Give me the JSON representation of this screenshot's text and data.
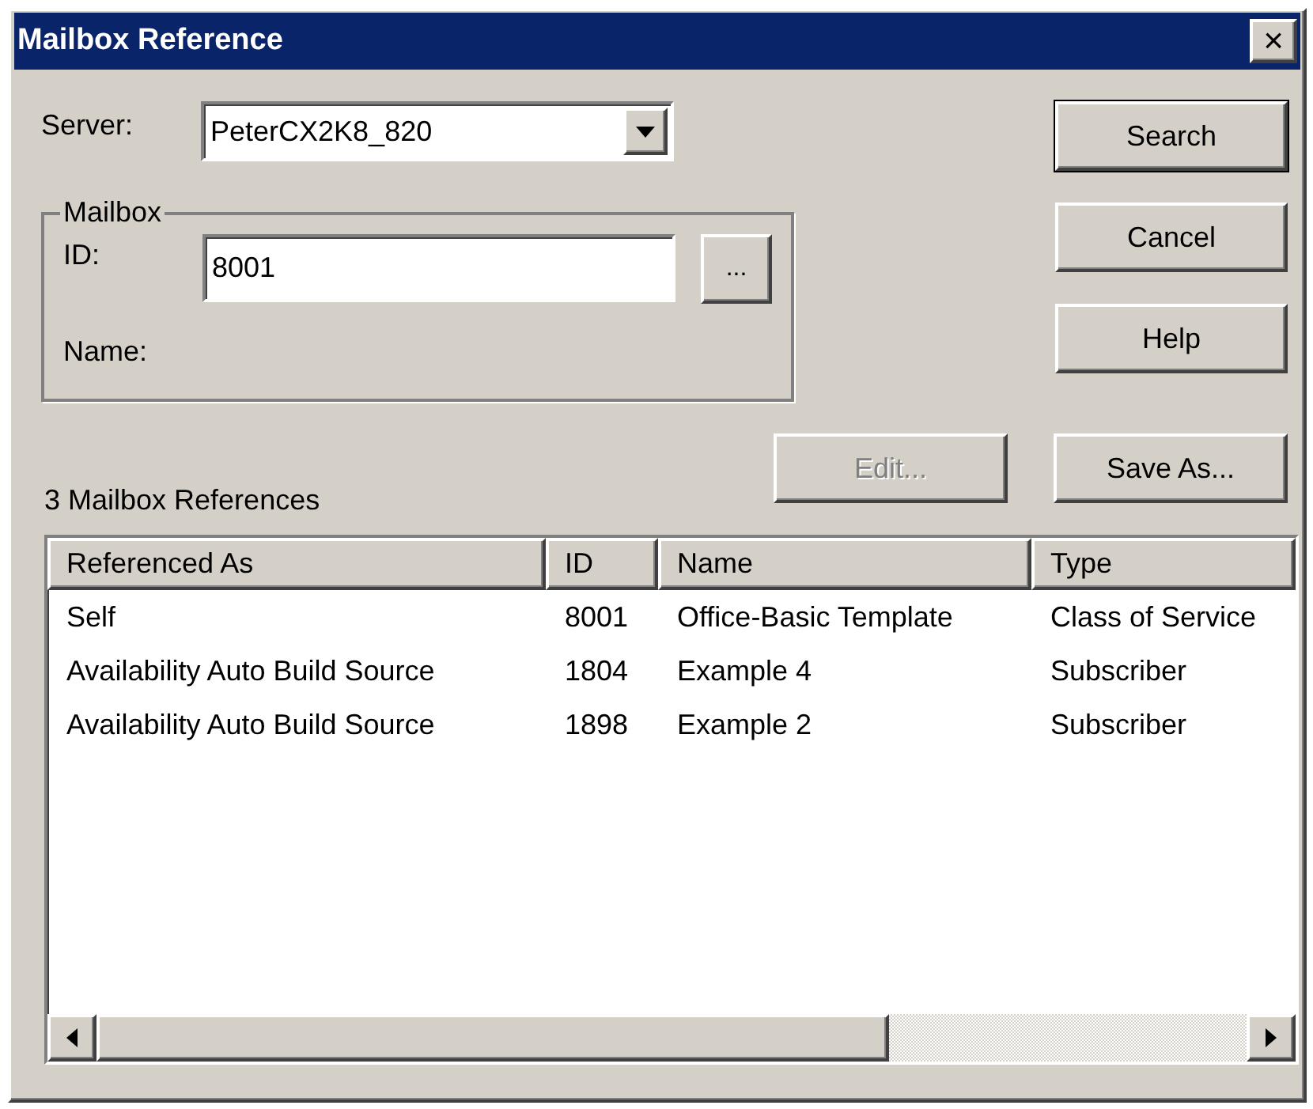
{
  "window": {
    "title": "Mailbox Reference",
    "close": "×"
  },
  "server": {
    "label": "Server:",
    "value": "PeterCX2K8_820"
  },
  "mailbox": {
    "legend": "Mailbox",
    "id_label": "ID:",
    "id_value": "8001",
    "browse": "...",
    "name_label": "Name:"
  },
  "action_buttons": [
    {
      "label": "Search",
      "default": true
    },
    {
      "label": "Cancel",
      "default": false
    },
    {
      "label": "Help",
      "default": false
    }
  ],
  "list_buttons": [
    {
      "label": "Edit...",
      "disabled": true
    },
    {
      "label": "Save As...",
      "disabled": false
    }
  ],
  "list_title": "3 Mailbox References",
  "table": {
    "columns": [
      "Referenced As",
      "ID",
      "Name",
      "Type"
    ],
    "rows": [
      [
        "Self",
        "8001",
        "Office-Basic Template",
        "Class of Service"
      ],
      [
        "Availability Auto Build Source",
        "1804",
        "Example 4",
        "Subscriber"
      ],
      [
        "Availability Auto Build Source",
        "1898",
        "Example 2",
        "Subscriber"
      ]
    ]
  }
}
